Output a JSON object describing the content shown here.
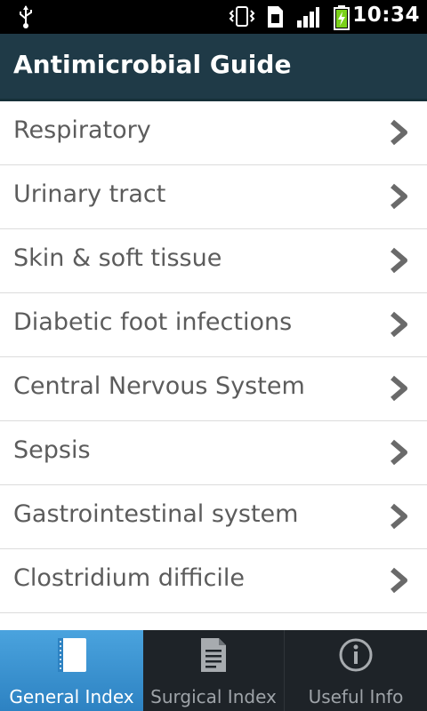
{
  "status_bar": {
    "time": "10:34",
    "icons": [
      "usb-icon",
      "vibrate-icon",
      "sim-icon",
      "signal-icon",
      "battery-charging-icon"
    ]
  },
  "header": {
    "title": "Antimicrobial Guide"
  },
  "list": {
    "items": [
      {
        "label": "Respiratory"
      },
      {
        "label": "Urinary tract"
      },
      {
        "label": "Skin & soft tissue"
      },
      {
        "label": "Diabetic foot infections"
      },
      {
        "label": "Central Nervous System"
      },
      {
        "label": "Sepsis"
      },
      {
        "label": "Gastrointestinal system"
      },
      {
        "label": "Clostridium difficile"
      }
    ]
  },
  "tabs": [
    {
      "label": "General Index",
      "icon": "book-icon",
      "selected": true
    },
    {
      "label": "Surgical Index",
      "icon": "document-icon",
      "selected": false
    },
    {
      "label": "Useful Info",
      "icon": "info-icon",
      "selected": false
    }
  ],
  "colors": {
    "header_bg": "#1f3a47",
    "tab_selected": "#3a95d4",
    "tabbar_bg": "#1e2328",
    "list_text": "#5c5c5c",
    "chevron": "#6a6a6a"
  }
}
